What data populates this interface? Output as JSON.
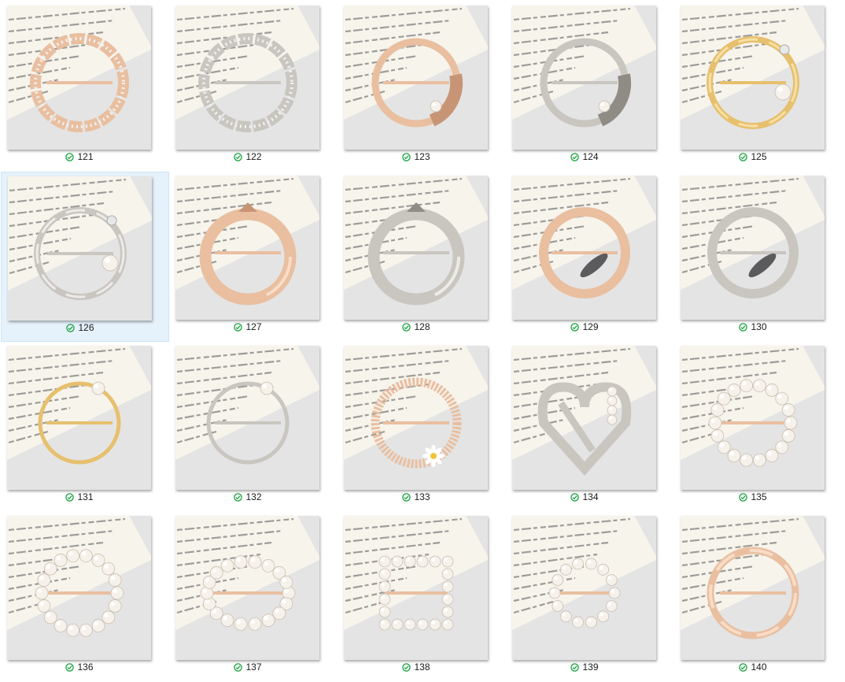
{
  "colors": {
    "status_ok": "#15a13c",
    "selection_bg": "#e5f1fb",
    "thumb_bg": "#e4e4e4",
    "paper": "#f7f4ec"
  },
  "items": [
    {
      "label": "121",
      "status_icon": "synced-check-icon",
      "metal": "rose-gold",
      "shape": "flower-rhinestone"
    },
    {
      "label": "122",
      "status_icon": "synced-check-icon",
      "metal": "silver",
      "shape": "flower-rhinestone"
    },
    {
      "label": "123",
      "status_icon": "synced-check-icon",
      "metal": "rose-gold",
      "shape": "ring-pearl"
    },
    {
      "label": "124",
      "status_icon": "synced-check-icon",
      "metal": "silver",
      "shape": "ring-pearl"
    },
    {
      "label": "125",
      "status_icon": "synced-check-icon",
      "metal": "gold",
      "shape": "twist-pearl"
    },
    {
      "label": "126",
      "status_icon": "synced-check-icon",
      "metal": "silver",
      "shape": "twist-pearl",
      "selected": true
    },
    {
      "label": "127",
      "status_icon": "synced-check-icon",
      "metal": "rose-gold",
      "shape": "fox-ring"
    },
    {
      "label": "128",
      "status_icon": "synced-check-icon",
      "metal": "silver",
      "shape": "fox-ring"
    },
    {
      "label": "129",
      "status_icon": "synced-check-icon",
      "metal": "rose-gold",
      "shape": "ring-leaf"
    },
    {
      "label": "130",
      "status_icon": "synced-check-icon",
      "metal": "silver",
      "shape": "ring-leaf"
    },
    {
      "label": "131",
      "status_icon": "synced-check-icon",
      "metal": "gold",
      "shape": "thin-ring-pearl"
    },
    {
      "label": "132",
      "status_icon": "synced-check-icon",
      "metal": "silver",
      "shape": "thin-ring-pearl"
    },
    {
      "label": "133",
      "status_icon": "synced-check-icon",
      "metal": "rose-gold",
      "shape": "daisy-ring"
    },
    {
      "label": "134",
      "status_icon": "synced-check-icon",
      "metal": "silver",
      "shape": "heart-pearl"
    },
    {
      "label": "135",
      "status_icon": "synced-check-icon",
      "metal": "rose-gold",
      "shape": "pearl-heart"
    },
    {
      "label": "136",
      "status_icon": "synced-check-icon",
      "metal": "rose-gold",
      "shape": "pearl-circle"
    },
    {
      "label": "137",
      "status_icon": "synced-check-icon",
      "metal": "rose-gold",
      "shape": "pearl-oval"
    },
    {
      "label": "138",
      "status_icon": "synced-check-icon",
      "metal": "rose-gold",
      "shape": "pearl-square"
    },
    {
      "label": "139",
      "status_icon": "synced-check-icon",
      "metal": "rose-gold",
      "shape": "pearl-small-circle"
    },
    {
      "label": "140",
      "status_icon": "synced-check-icon",
      "metal": "rose-gold",
      "shape": "twist-ring"
    }
  ]
}
